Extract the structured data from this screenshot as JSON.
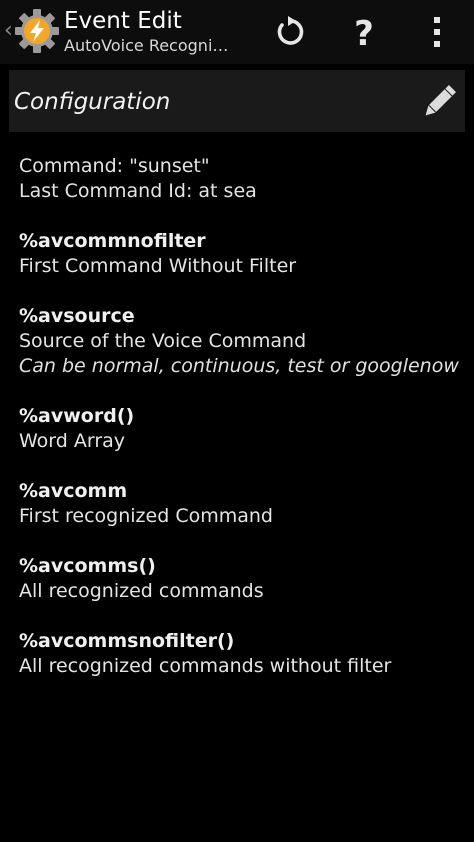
{
  "action_bar": {
    "title": "Event Edit",
    "subtitle": "AutoVoice Recogni…",
    "back_glyph": "‹",
    "icons": {
      "app": "tasker-gear-icon",
      "revert": "revert-icon",
      "help": "help-icon",
      "overflow": "overflow-menu-icon"
    },
    "help_glyph": "?"
  },
  "config_header": {
    "title": "Configuration",
    "edit_icon": "pencil-icon"
  },
  "command_info": {
    "command": "Command: \"sunset\"",
    "last_command_id": "Last Command Id: at sea"
  },
  "variables": [
    {
      "name": "%avcommnofilter",
      "description": "First Command Without Filter"
    },
    {
      "name": "%avsource",
      "description": "Source of the Voice Command",
      "note": "Can be normal, continuous, test or googlenow"
    },
    {
      "name": "%avword()",
      "description": "Word Array"
    },
    {
      "name": "%avcomm",
      "description": "First recognized Command"
    },
    {
      "name": "%avcomms()",
      "description": "All recognized commands"
    },
    {
      "name": "%avcommsnofilter()",
      "description": "All recognized commands without filter"
    }
  ],
  "colors": {
    "background": "#000000",
    "action_bar": "#0d0d0d",
    "header_panel": "#1a1a1a",
    "icon_orange": "#f5a623",
    "text": "#e4e4e4"
  }
}
